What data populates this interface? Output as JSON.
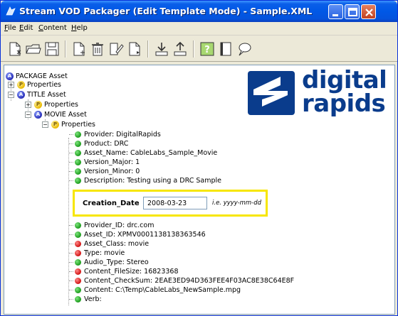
{
  "window": {
    "title": "Stream VOD Packager (Edit Template Mode) - Sample.XML"
  },
  "menu": [
    {
      "label": "File",
      "mnemonic": "F",
      "rest": "ile"
    },
    {
      "label": "Edit",
      "mnemonic": "E",
      "rest": "dit"
    },
    {
      "label": "Content",
      "mnemonic": "C",
      "rest": "ontent"
    },
    {
      "label": "Help",
      "mnemonic": "H",
      "rest": "elp"
    }
  ],
  "toolbar": {
    "buttons": [
      "new-template-icon",
      "open-folder-icon",
      "save-disk-icon",
      "new-node-icon",
      "delete-trash-icon",
      "edit-note-icon",
      "document-icon",
      "download-icon",
      "upload-icon",
      "help-icon",
      "book-icon",
      "chat-bubble-icon"
    ]
  },
  "logo": {
    "line1": "digital",
    "line2": "rapids",
    "brand_color": "#0a3c8c"
  },
  "tree": {
    "package_asset": "PACKAGE Asset",
    "package_properties": "Properties",
    "title_asset": "TITLE Asset",
    "title_properties": "Properties",
    "movie_asset": "MOVIE Asset",
    "movie_properties": "Properties",
    "items_before": [
      {
        "text": "Provider: DigitalRapids",
        "status": "green"
      },
      {
        "text": "Product: DRC",
        "status": "green"
      },
      {
        "text": "Asset_Name: CableLabs_Sample_Movie",
        "status": "green"
      },
      {
        "text": "Version_Major: 1",
        "status": "green"
      },
      {
        "text": "Version_Minor: 0",
        "status": "green"
      },
      {
        "text": "Description: Testing using a DRC Sample",
        "status": "green"
      }
    ],
    "edit": {
      "label": "Creation_Date",
      "value": "2008-03-23",
      "hint": "i.e. yyyy-mm-dd",
      "highlight_color": "#f7e600"
    },
    "items_after": [
      {
        "text": "Provider_ID: drc.com",
        "status": "green"
      },
      {
        "text": "Asset_ID: XPMV0001138138363546",
        "status": "green"
      },
      {
        "text": "Asset_Class: movie",
        "status": "red"
      },
      {
        "text": "Type: movie",
        "status": "red"
      },
      {
        "text": "Audio_Type: Stereo",
        "status": "green"
      },
      {
        "text": "Content_FileSize: 16823368",
        "status": "red"
      },
      {
        "text": "Content_CheckSum: 2EAE3ED94D363FEE4F03AC8E38C64E8F",
        "status": "red"
      },
      {
        "text": "Content: C:\\Temp\\CableLabs_NewSample.mpg",
        "status": "green"
      },
      {
        "text": "Verb:",
        "status": "green"
      }
    ]
  }
}
